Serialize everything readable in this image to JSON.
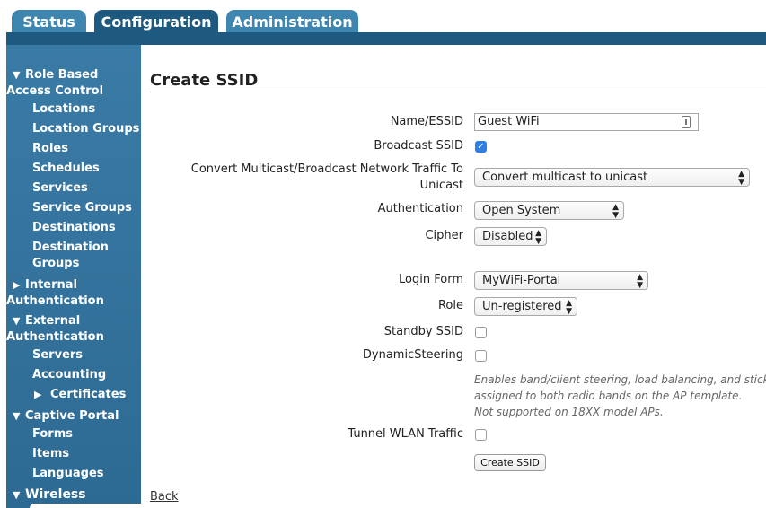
{
  "tabs": [
    {
      "label": "Status"
    },
    {
      "label": "Configuration"
    },
    {
      "label": "Administration"
    }
  ],
  "sidebar": {
    "rbac": {
      "line1": "Role Based",
      "line2": "Access Control"
    },
    "rbac_items": [
      "Locations",
      "Location Groups",
      "Roles",
      "Schedules",
      "Services",
      "Service Groups",
      "Destinations"
    ],
    "dest_groups": {
      "line1": "Destination",
      "line2": "Groups"
    },
    "internal": {
      "line1": "Internal",
      "line2": "Authentication"
    },
    "external": {
      "line1": "External",
      "line2": "Authentication"
    },
    "external_items": [
      "Servers",
      "Accounting"
    ],
    "certificates": "Certificates",
    "captive": "Captive Portal",
    "captive_items": [
      "Forms",
      "Items",
      "Languages"
    ],
    "wireless": "Wireless"
  },
  "page": {
    "title": "Create SSID"
  },
  "form": {
    "name_label": "Name/ESSID",
    "name_value": "Guest WiFi",
    "broadcast_label": "Broadcast SSID",
    "broadcast_checked": true,
    "multicast_label_line1": "Convert Multicast/Broadcast Network Traffic To",
    "multicast_label_line2": "Unicast",
    "multicast_value": "Convert multicast to unicast",
    "auth_label": "Authentication",
    "auth_value": "Open System",
    "cipher_label": "Cipher",
    "cipher_value": "Disabled",
    "login_form_label": "Login Form",
    "login_form_value": "MyWiFi-Portal",
    "role_label": "Role",
    "role_value": "Un-registered",
    "standby_label": "Standby SSID",
    "standby_checked": false,
    "steering_label": "DynamicSteering",
    "steering_checked": false,
    "steering_help_line1": "Enables band/client steering, load balancing, and sticky",
    "steering_help_line2": "assigned to both radio bands on the AP template.",
    "steering_help_line3": "Not supported on 18XX model APs.",
    "tunnel_label": "Tunnel WLAN Traffic",
    "tunnel_checked": false,
    "create_button": "Create SSID",
    "back_link": "Back"
  },
  "colors": {
    "tab_active": "#1e5a80",
    "tab_inactive": "#3e86b0",
    "sidebar": "#3a7ba6",
    "checkbox_checked": "#2f7ee6"
  }
}
